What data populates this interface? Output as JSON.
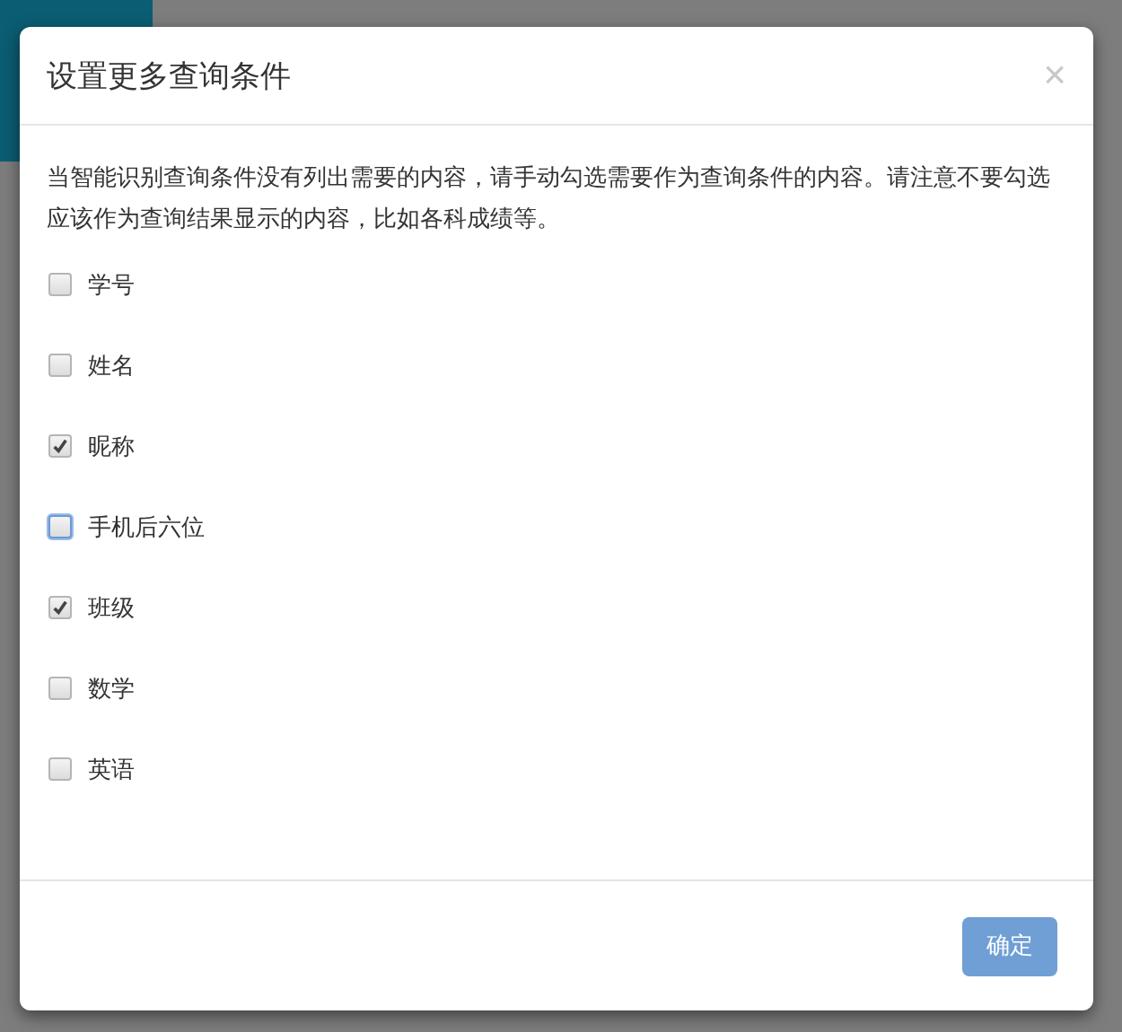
{
  "dialog": {
    "title": "设置更多查询条件",
    "close": "×",
    "description": "当智能识别查询条件没有列出需要的内容，请手动勾选需要作为查询条件的内容。请注意不要勾选应该作为查询结果显示的内容，比如各科成绩等。",
    "options": [
      {
        "label": "学号",
        "checked": false,
        "focused": false
      },
      {
        "label": "姓名",
        "checked": false,
        "focused": false
      },
      {
        "label": "昵称",
        "checked": true,
        "focused": false
      },
      {
        "label": "手机后六位",
        "checked": false,
        "focused": true
      },
      {
        "label": "班级",
        "checked": true,
        "focused": false
      },
      {
        "label": "数学",
        "checked": false,
        "focused": false
      },
      {
        "label": "英语",
        "checked": false,
        "focused": false
      }
    ],
    "confirm": {
      "label": "确定",
      "disabled": true
    }
  }
}
